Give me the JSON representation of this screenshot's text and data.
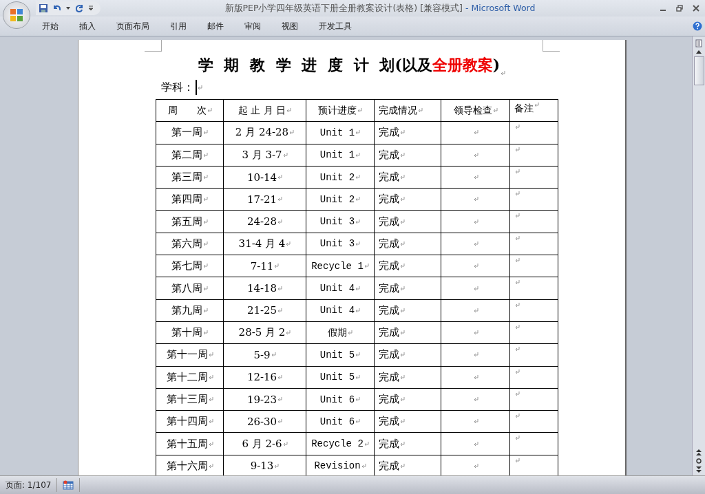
{
  "window": {
    "title": "新版PEP小学四年级英语下册全册教案设计(表格) [兼容模式]",
    "app": "- Microsoft Word"
  },
  "ribbon_tabs": [
    {
      "label": "开始",
      "selected": false
    },
    {
      "label": "插入",
      "selected": false
    },
    {
      "label": "页面布局",
      "selected": false
    },
    {
      "label": "引用",
      "selected": false
    },
    {
      "label": "邮件",
      "selected": false
    },
    {
      "label": "审阅",
      "selected": false
    },
    {
      "label": "视图",
      "selected": false
    },
    {
      "label": "开发工具",
      "selected": false
    }
  ],
  "document": {
    "show_formatting_marks": true,
    "title": {
      "text": "学 期 教 学 进 度 计 划(以及",
      "highlight": "全册教案",
      "end": ")"
    },
    "subject_label": "学科：",
    "table": {
      "columns": [
        "周　　次",
        "起 止 月 日",
        "预计进度",
        "完成情况",
        "领导检查",
        "备注"
      ],
      "rows": [
        [
          "第一周",
          "2 月 24-28",
          "Unit 1",
          "完成"
        ],
        [
          "第二周",
          "3 月 3-7",
          "Unit 1",
          "完成"
        ],
        [
          "第三周",
          "10-14",
          "Unit 2",
          "完成"
        ],
        [
          "第四周",
          "17-21",
          "Unit 2",
          "完成"
        ],
        [
          "第五周",
          "24-28",
          "Unit 3",
          "完成"
        ],
        [
          "第六周",
          "31-4 月 4",
          "Unit 3",
          "完成"
        ],
        [
          "第七周",
          "7-11",
          "Recycle 1",
          "完成"
        ],
        [
          "第八周",
          "14-18",
          "Unit 4",
          "完成"
        ],
        [
          "第九周",
          "21-25",
          "Unit 4",
          "完成"
        ],
        [
          "第十周",
          "28-5 月 2",
          "假期",
          "完成"
        ],
        [
          "第十一周",
          "5-9",
          "Unit 5",
          "完成"
        ],
        [
          "第十二周",
          "12-16",
          "Unit 5",
          "完成"
        ],
        [
          "第十三周",
          "19-23",
          "Unit 6",
          "完成"
        ],
        [
          "第十四周",
          "26-30",
          "Unit 6",
          "完成"
        ],
        [
          "第十五周",
          "6 月 2-6",
          "Recycle 2",
          "完成"
        ],
        [
          "第十六周",
          "9-13",
          "Revision",
          "完成"
        ]
      ]
    }
  },
  "status_bar": {
    "page": "页面: 1/107"
  }
}
